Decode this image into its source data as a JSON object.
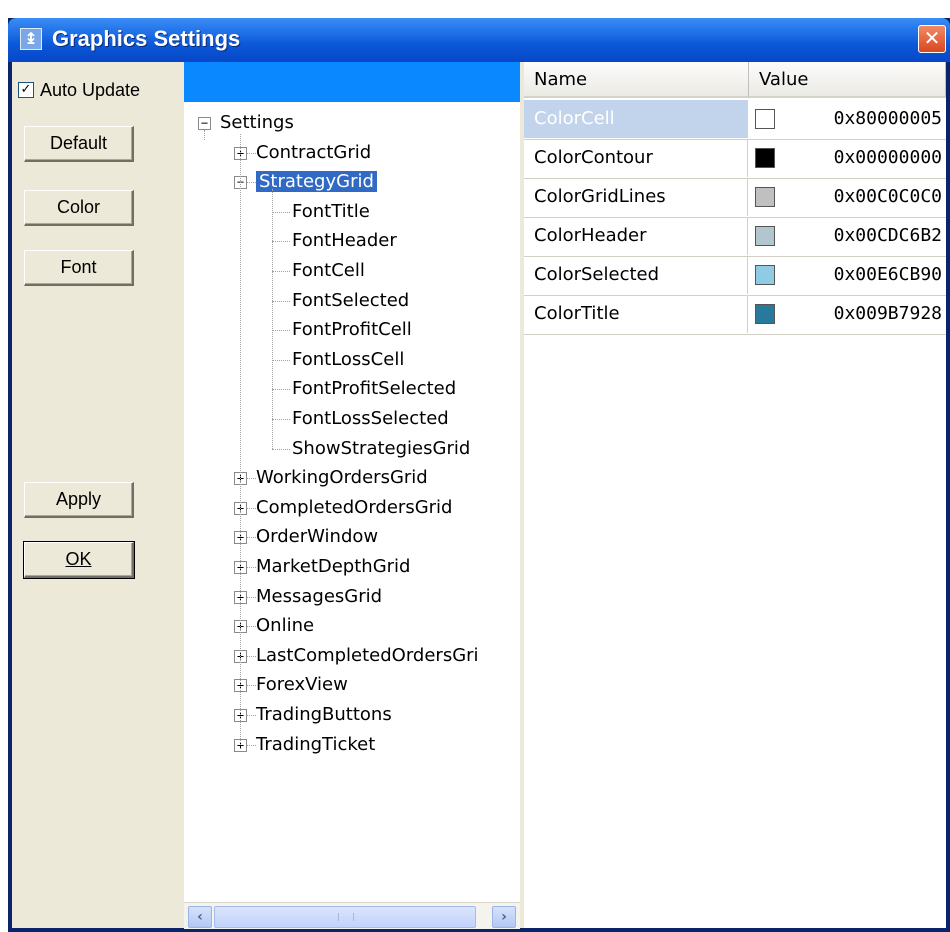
{
  "window": {
    "title": "Graphics Settings",
    "close_label": "✕"
  },
  "left": {
    "auto_update": {
      "label": "Auto Update",
      "checked": true
    },
    "buttons": {
      "default": "Default",
      "color": "Color",
      "font": "Font",
      "apply": "Apply",
      "ok": "OK"
    }
  },
  "tree": {
    "root": "Settings",
    "nodes": [
      {
        "label": "ContractGrid",
        "expanded": false
      },
      {
        "label": "StrategyGrid",
        "expanded": true,
        "selected": true,
        "children": [
          "FontTitle",
          "FontHeader",
          "FontCell",
          "FontSelected",
          "FontProfitCell",
          "FontLossCell",
          "FontProfitSelected",
          "FontLossSelected",
          "ShowStrategiesGrid"
        ]
      },
      {
        "label": "WorkingOrdersGrid",
        "expanded": false
      },
      {
        "label": "CompletedOrdersGrid",
        "expanded": false
      },
      {
        "label": "OrderWindow",
        "expanded": false
      },
      {
        "label": "MarketDepthGrid",
        "expanded": false
      },
      {
        "label": "MessagesGrid",
        "expanded": false
      },
      {
        "label": "Online",
        "expanded": false
      },
      {
        "label": "LastCompletedOrdersGri",
        "expanded": false
      },
      {
        "label": "ForexView",
        "expanded": false
      },
      {
        "label": "TradingButtons",
        "expanded": false
      },
      {
        "label": "TradingTicket",
        "expanded": false
      }
    ]
  },
  "grid": {
    "columns": [
      "Name",
      "Value"
    ],
    "rows": [
      {
        "name": "ColorCell",
        "value": "0x80000005",
        "color": "#ffffff",
        "selected": true
      },
      {
        "name": "ColorContour",
        "value": "0x00000000",
        "color": "#000000"
      },
      {
        "name": "ColorGridLines",
        "value": "0x00C0C0C0",
        "color": "#c0c0c0"
      },
      {
        "name": "ColorHeader",
        "value": "0x00CDC6B2",
        "color": "#b2c6cd"
      },
      {
        "name": "ColorSelected",
        "value": "0x00E6CB90",
        "color": "#90cbe6"
      },
      {
        "name": "ColorTitle",
        "value": "0x009B7928",
        "color": "#28799b"
      }
    ]
  },
  "scrollbar": {
    "left_arrow": "‹",
    "right_arrow": "›"
  }
}
